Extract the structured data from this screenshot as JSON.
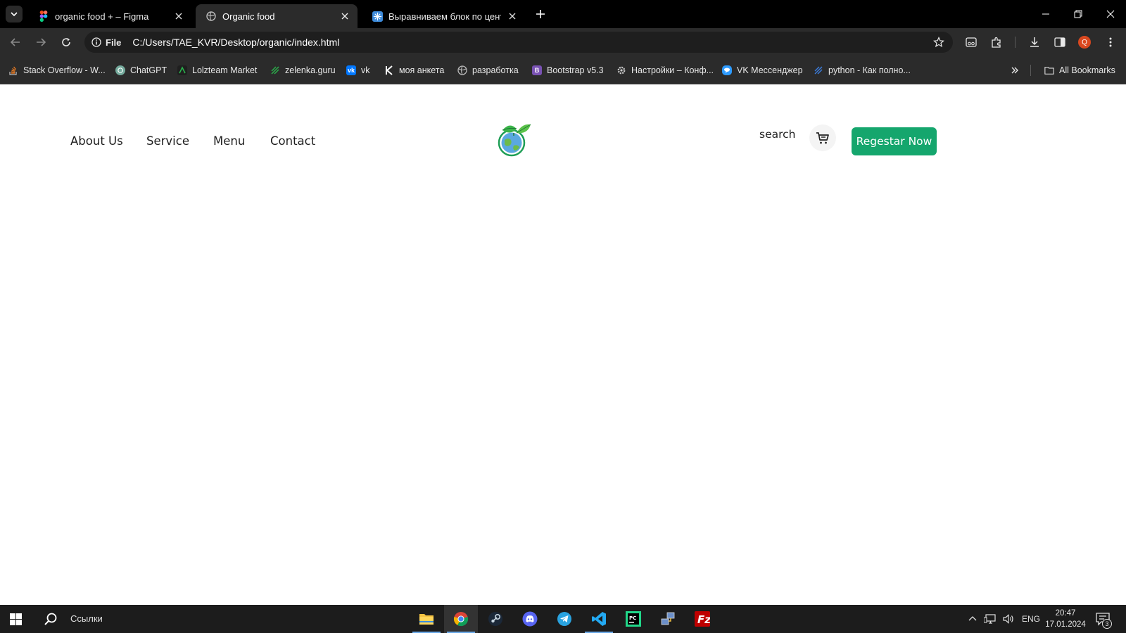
{
  "browser": {
    "tabs": [
      {
        "title": "organic food + – Figma",
        "icon": "figma-icon",
        "active": false
      },
      {
        "title": "Organic food",
        "icon": "globe-icon",
        "active": true
      },
      {
        "title": "Выравниваем блок по центру",
        "icon": "snowflake-icon",
        "active": false
      }
    ],
    "address": {
      "scheme_label": "File",
      "url": "C:/Users/TAE_KVR/Desktop/organic/index.html"
    },
    "profile_initial": "Q",
    "bookmarks": [
      {
        "label": "Stack Overflow - W...",
        "icon": "stackoverflow-icon",
        "color": "#f48024"
      },
      {
        "label": "ChatGPT",
        "icon": "chatgpt-icon",
        "color": "#74aa9c"
      },
      {
        "label": "Lolzteam Market",
        "icon": "lolzteam-icon",
        "color": "#2b9a4a"
      },
      {
        "label": "zelenka.guru",
        "icon": "zelenka-icon",
        "color": "#2b9a4a"
      },
      {
        "label": "vk",
        "icon": "vk-icon",
        "color": "#0077ff"
      },
      {
        "label": "моя анкета",
        "icon": "k-icon",
        "color": "#ffffff"
      },
      {
        "label": "разработка",
        "icon": "globe-icon",
        "color": "#bbbbbb"
      },
      {
        "label": "Bootstrap v5.3",
        "icon": "bootstrap-icon",
        "color": "#7952b3"
      },
      {
        "label": "Настройки – Конф...",
        "icon": "gear-icon",
        "color": "#cccccc"
      },
      {
        "label": "VK Мессенджер",
        "icon": "vk-messenger-icon",
        "color": "#2e9bff"
      },
      {
        "label": "python - Как полно...",
        "icon": "python-doc-icon",
        "color": "#3b7ddd"
      }
    ],
    "all_bookmarks_label": "All Bookmarks"
  },
  "site": {
    "nav": [
      "About Us",
      "Service",
      "Menu",
      "Contact"
    ],
    "search_label": "search",
    "cta_label": "Regestar Now",
    "accent": "#15a66d"
  },
  "taskbar": {
    "search_label": "Ссылки",
    "apps": [
      {
        "name": "file-explorer-icon",
        "active": false
      },
      {
        "name": "chrome-icon",
        "active": true
      },
      {
        "name": "steam-icon",
        "active": false
      },
      {
        "name": "discord-icon",
        "active": false
      },
      {
        "name": "telegram-icon",
        "active": false
      },
      {
        "name": "vscode-icon",
        "active": false
      },
      {
        "name": "pycharm-icon",
        "active": false
      },
      {
        "name": "network-tool-icon",
        "active": false
      },
      {
        "name": "filezilla-icon",
        "active": false
      }
    ],
    "language": "ENG",
    "time": "20:47",
    "date": "17.01.2024",
    "notification_count": "3"
  }
}
